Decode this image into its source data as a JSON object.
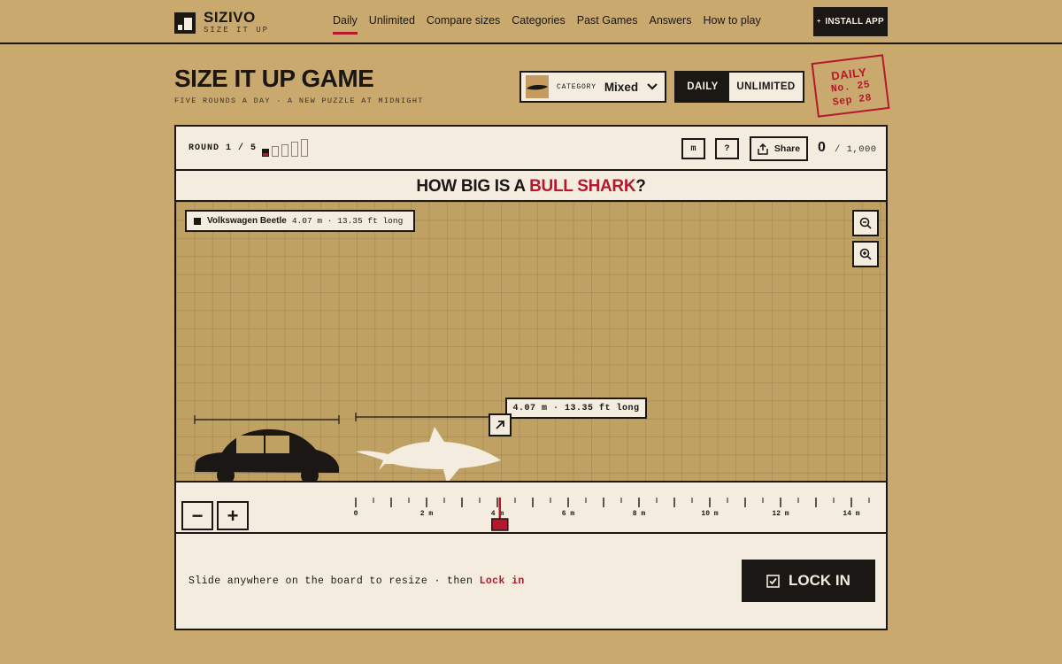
{
  "brand": {
    "name": "SIZIVO",
    "tagline": "SIZE IT UP"
  },
  "nav": {
    "items": [
      {
        "label": "Daily",
        "active": true
      },
      {
        "label": "Unlimited"
      },
      {
        "label": "Compare sizes"
      },
      {
        "label": "Categories"
      },
      {
        "label": "Past Games"
      },
      {
        "label": "Answers"
      },
      {
        "label": "How to play"
      }
    ],
    "install_label": "INSTALL APP"
  },
  "header": {
    "title": "SIZE IT UP GAME",
    "subtitle": "FIVE ROUNDS A DAY · A NEW PUZZLE AT MIDNIGHT",
    "category_label": "CATEGORY",
    "category_value": "Mixed",
    "mode_daily": "DAILY",
    "mode_unlimited": "UNLIMITED",
    "active_mode": "DAILY",
    "stamp": {
      "title": "DAILY",
      "number": "No. 25",
      "date": "Sep 28"
    }
  },
  "game": {
    "round_text": "ROUND 1 / 5",
    "round_current": 1,
    "round_total": 5,
    "unit_button": "m",
    "help_button": "?",
    "share_label": "Share",
    "score": "0",
    "score_max": "/ 1,000",
    "question_prefix": "HOW BIG IS A ",
    "question_subject": "BULL SHARK",
    "question_suffix": "?",
    "reference": {
      "name": "Volkswagen Beetle",
      "measure": "4.07 m · 13.35 ft long",
      "length_m": 4.07
    },
    "guess": {
      "measure": "4.07 m · 13.35 ft long",
      "length_m": 4.07
    },
    "ruler": {
      "min_m": 0,
      "max_m": 15,
      "labels": [
        "0",
        "2 m",
        "4 m",
        "6 m",
        "8 m",
        "10 m",
        "12 m",
        "14 m"
      ]
    },
    "hint_text": "Slide anywhere on the board to resize · then ",
    "hint_action": "Lock in",
    "lock_label": "LOCK IN"
  },
  "colors": {
    "background": "#c9a96e",
    "ink": "#1a1714",
    "paper": "#f3ecdf",
    "accent": "#b5182b",
    "board": "#c0a164"
  },
  "icons": [
    "logo-icon",
    "chevron-down-icon",
    "share-icon",
    "zoom-out-icon",
    "zoom-in-icon",
    "resize-arrow-icon",
    "checkbox-icon",
    "car-silhouette-icon",
    "shark-silhouette-icon"
  ]
}
